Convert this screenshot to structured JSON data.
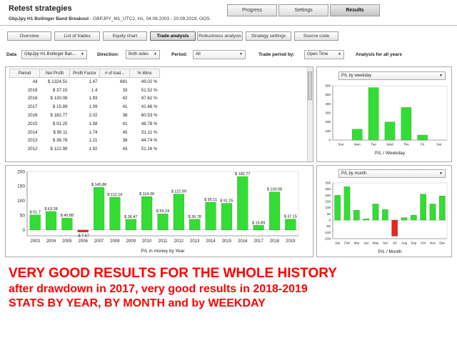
{
  "app": {
    "title": "Retest strategies",
    "strategy": "GbpJpy H1 Bollinger Band Breakout",
    "params": " - GBPJPY_M1_UTC2, H1, 04.08.2003 - 20.09.2019, OOS:"
  },
  "top_tabs": [
    {
      "label": "Progress",
      "active": false
    },
    {
      "label": "Settings",
      "active": false
    },
    {
      "label": "Results",
      "active": true
    }
  ],
  "sub_tabs": [
    {
      "label": "Overview",
      "active": false
    },
    {
      "label": "List of trades",
      "active": false
    },
    {
      "label": "Equity chart",
      "active": false
    },
    {
      "label": "Trade analysis",
      "active": true
    },
    {
      "label": "Robustness analysis",
      "active": false
    },
    {
      "label": "Strategy settings",
      "active": false
    },
    {
      "label": "Source code",
      "active": false
    }
  ],
  "filters": {
    "data_label": "Data",
    "data_value": "GbpJpy H1 Bollinger Ban...",
    "direction_label": "Direction:",
    "direction_value": "Both sides",
    "period_label": "Period:",
    "period_value": "All",
    "trade_period_label": "Trade period by:",
    "trade_period_value": "Open Time",
    "analysis_label": "Analysis for all years"
  },
  "year_table": {
    "headers": [
      "Period",
      "Net Profit",
      "Profit Factor",
      "# of trad...",
      "% Wins"
    ],
    "rows": [
      [
        "All",
        "$ 1324.51",
        "1.47",
        "661",
        "49.02 %"
      ],
      [
        "2019",
        "$ 37.15",
        "1.4",
        "33",
        "51.52 %"
      ],
      [
        "2018",
        "$ 130.08",
        "1.93",
        "42",
        "47.62 %"
      ],
      [
        "2017",
        "$ 15.89",
        "1.09",
        "41",
        "41.46 %"
      ],
      [
        "2016",
        "$ 182.77",
        "2.02",
        "38",
        "60.53 %"
      ],
      [
        "2015",
        "$ 91.25",
        "1.58",
        "41",
        "48.78 %"
      ],
      [
        "2014",
        "$ 95.11",
        "1.74",
        "45",
        "51.11 %"
      ],
      [
        "2013",
        "$ 36.78",
        "1.21",
        "38",
        "44.74 %"
      ],
      [
        "2012",
        "$ 122.99",
        "1.92",
        "43",
        "51.16 %"
      ]
    ]
  },
  "weekday_select": "P/L by weekday",
  "month_select": "P/L by month",
  "colors": {
    "positive": "#33dd33",
    "negative": "#ee2222",
    "accent_text": "#1a2fd6",
    "note": "#ff0000"
  },
  "chart_data": [
    {
      "type": "bar",
      "title": "P/L in money by Year",
      "categories": [
        "2003",
        "2004",
        "2005",
        "2006",
        "2007",
        "2008",
        "2009",
        "2010",
        "2011",
        "2012",
        "2013",
        "2014",
        "2015",
        "2016",
        "2017",
        "2018",
        "2019"
      ],
      "values": [
        51.7,
        63.28,
        40.88,
        -7.47,
        145.86,
        112.16,
        36.47,
        114.36,
        55.24,
        122.99,
        36.78,
        95.11,
        91.25,
        182.77,
        15.89,
        130.08,
        37.15
      ],
      "data_labels": [
        "$ 51.7",
        "$ 63.28",
        "$ 40.88",
        "-$ 7.47",
        "$ 145.86",
        "$ 112.16",
        "$ 36.47",
        "$ 114.36",
        "$ 55.24",
        "$ 122.99",
        "$ 36.78",
        "$ 95.11",
        "$ 91.25",
        "$ 182.77",
        "$ 15.89",
        "$ 130.08",
        "$ 37.15"
      ],
      "yticks": [
        0,
        50,
        100,
        150,
        200
      ],
      "ylim": [
        -20,
        200
      ],
      "grid": false
    },
    {
      "type": "bar",
      "title": "P/L / Weekday",
      "categories": [
        "Sun",
        "Mon",
        "Tue",
        "Wed",
        "Thu",
        "Fri",
        "Sat"
      ],
      "values": [
        0,
        120,
        580,
        200,
        360,
        55,
        0
      ],
      "yticks": [
        0,
        100,
        200,
        300,
        400,
        500,
        600
      ],
      "ylim": [
        0,
        600
      ]
    },
    {
      "type": "bar",
      "title": "P/L / Month",
      "categories": [
        "Jan",
        "Feb",
        "Mar",
        "Apr",
        "May",
        "Jun",
        "Jul",
        "Aug",
        "Sep",
        "Oct",
        "Nov",
        "Dec"
      ],
      "values": [
        200,
        270,
        80,
        10,
        130,
        85,
        -130,
        20,
        40,
        210,
        130,
        195
      ],
      "yticks": [
        -150,
        -100,
        -50,
        0,
        50,
        100,
        150,
        200,
        250,
        300
      ],
      "ylim": [
        -150,
        300
      ]
    }
  ],
  "notes": [
    "VERY GOOD RESULTS FOR THE WHOLE HISTORY",
    "after drawdown in 2017, very good results in 2018-2019",
    "STATS BY YEAR, BY MONTH and by WEEKDAY"
  ]
}
